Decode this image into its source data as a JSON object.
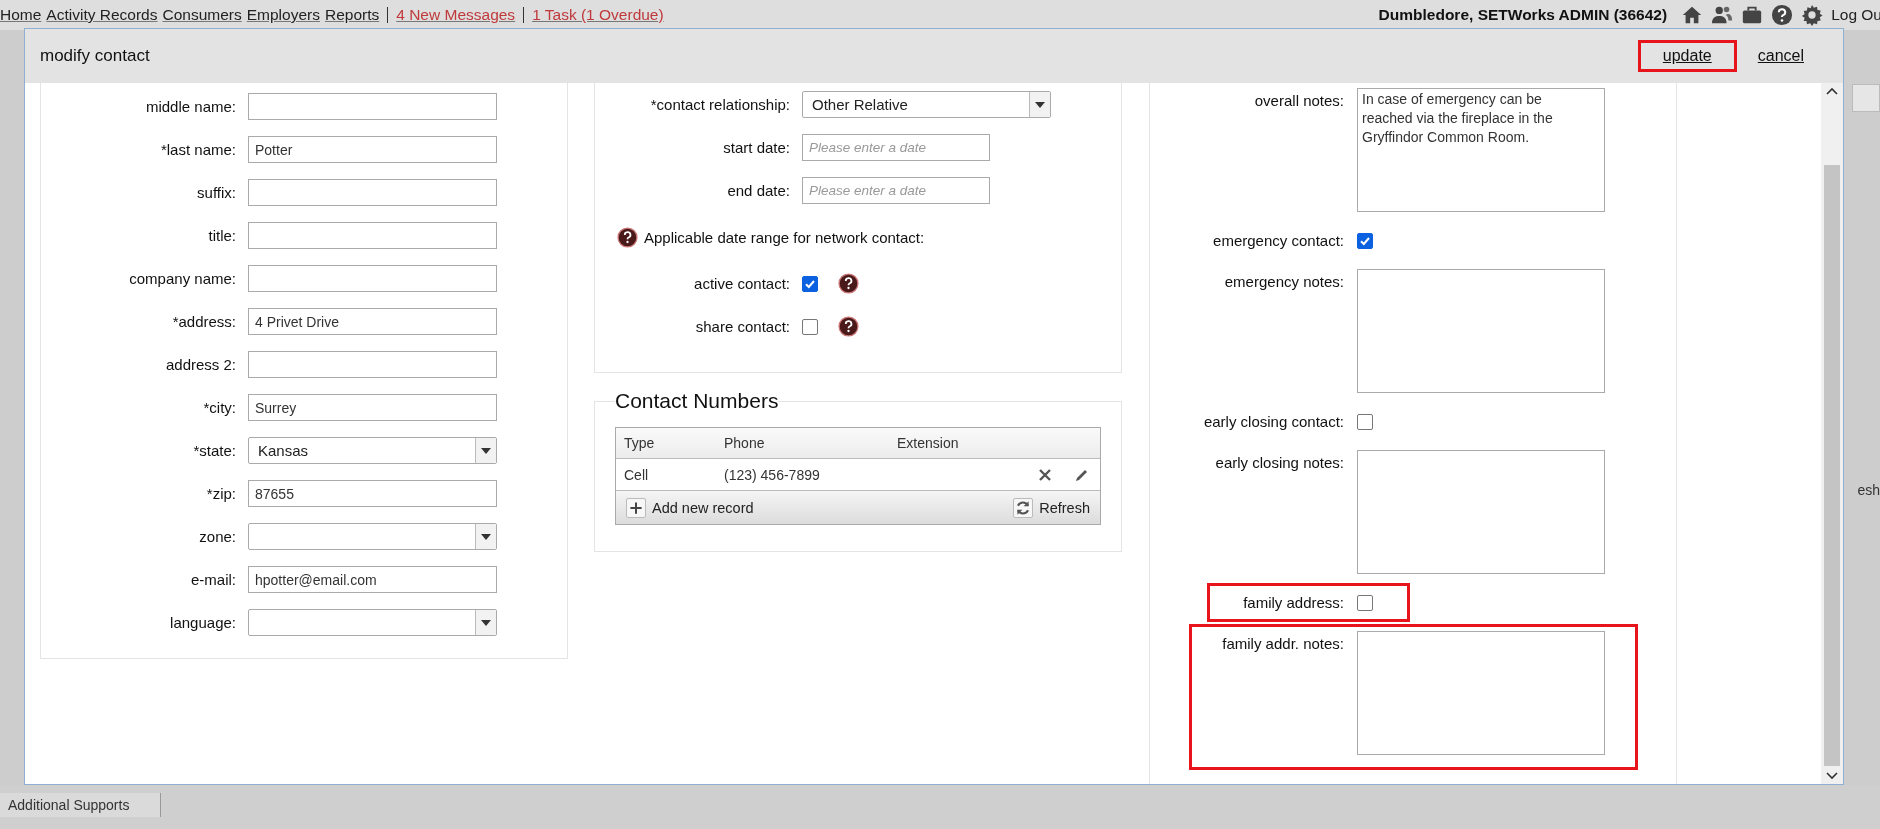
{
  "nav": {
    "links": [
      "Home",
      "Activity Records",
      "Consumers",
      "Employers",
      "Reports"
    ],
    "alerts": [
      "4 New Messages",
      "1 Task (1 Overdue)"
    ],
    "user": "Dumbledore, SETWorks ADMIN  (36642)",
    "logout": "Log Ou"
  },
  "dialog": {
    "title": "modify contact",
    "actions": [
      {
        "label": "update",
        "highlighted": true
      },
      {
        "label": "cancel",
        "highlighted": false
      }
    ]
  },
  "left_fields": [
    {
      "label": "middle name:",
      "kind": "text"
    },
    {
      "label": "*last name:",
      "kind": "text",
      "value": "Potter"
    },
    {
      "label": "suffix:",
      "kind": "text"
    },
    {
      "label": "title:",
      "kind": "text"
    },
    {
      "label": "company name:",
      "kind": "text"
    },
    {
      "label": "*address:",
      "kind": "text",
      "value": "4 Privet Drive"
    },
    {
      "label": "address 2:",
      "kind": "text"
    },
    {
      "label": "*city:",
      "kind": "text",
      "value": "Surrey"
    },
    {
      "label": "*state:",
      "kind": "select",
      "value": "Kansas"
    },
    {
      "label": "*zip:",
      "kind": "text",
      "value": "87655"
    },
    {
      "label": "zone:",
      "kind": "select"
    },
    {
      "label": "e-mail:",
      "kind": "text",
      "value": "hpotter@email.com"
    },
    {
      "label": "language:",
      "kind": "select"
    }
  ],
  "middle_fields": [
    {
      "label": "*contact relationship:",
      "kind": "select",
      "value": "Other Relative"
    },
    {
      "label": "start date:",
      "kind": "date",
      "placeholder": "Please enter a date"
    },
    {
      "label": "end date:",
      "kind": "date",
      "placeholder": "Please enter a date"
    },
    {
      "label": "Applicable date range for network contact:",
      "kind": "note"
    },
    {
      "label": "active contact:",
      "kind": "checkbox",
      "checked": true
    },
    {
      "label": "share contact:",
      "kind": "checkbox",
      "checked": false
    }
  ],
  "contact_numbers": {
    "title": "Contact Numbers",
    "columns": [
      "Type",
      "Phone",
      "Extension"
    ],
    "rows": [
      {
        "type": "Cell",
        "phone": "(123) 456-7899"
      }
    ],
    "add": "Add new record",
    "refresh": "Refresh"
  },
  "right_fields": [
    {
      "label": "overall notes:",
      "kind": "textarea",
      "value": "In case of emergency can be reached via the fireplace in the Gryffindor Common Room.",
      "highlighted": false
    },
    {
      "label": "emergency contact:",
      "kind": "checkbox",
      "checked": true,
      "highlighted": false
    },
    {
      "label": "emergency notes:",
      "kind": "textarea",
      "highlighted": false
    },
    {
      "label": "early closing contact:",
      "kind": "checkbox",
      "checked": false,
      "highlighted": false
    },
    {
      "label": "early closing notes:",
      "kind": "textarea",
      "highlighted": false
    },
    {
      "label": "family address:",
      "kind": "checkbox",
      "checked": false,
      "highlighted": true
    },
    {
      "label": "family addr. notes:",
      "kind": "textarea",
      "highlighted": true
    }
  ],
  "background": {
    "fragment": "esh",
    "tab": "Additional Supports"
  }
}
